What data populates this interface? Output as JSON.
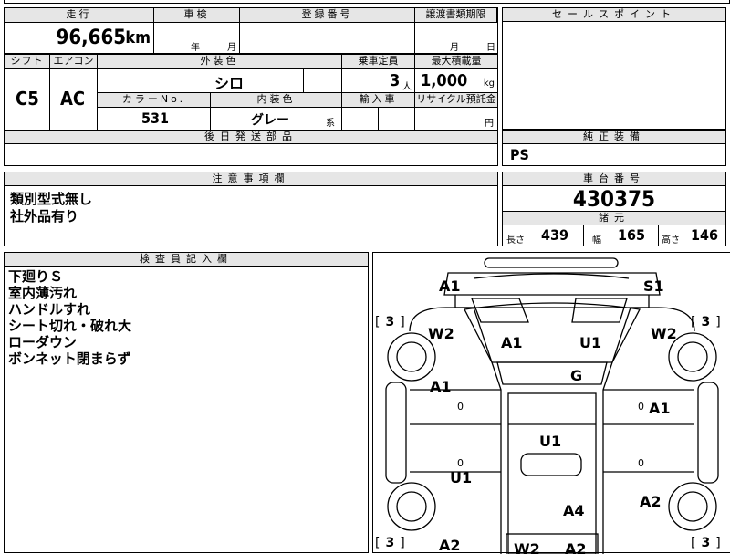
{
  "top_fragment": {
    "text": "…"
  },
  "basic": {
    "mileage_label": "走行",
    "mileage_value": "96,665",
    "mileage_unit": "km",
    "inspection_label": "車検",
    "inspection_year": "年",
    "inspection_month": "月",
    "reg_label": "登録番号",
    "transfer_label": "譲渡書類期限",
    "transfer_month": "月",
    "transfer_day": "日"
  },
  "spec": {
    "shift_label": "シフト",
    "shift_value": "C5",
    "aircon_label": "エアコン",
    "aircon_value": "AC",
    "exterior_label": "外装色",
    "exterior_value": "シロ",
    "capacity_label": "乗車定員",
    "capacity_value": "3",
    "capacity_unit": "人",
    "load_label": "最大積載量",
    "load_value": "1,000",
    "load_unit": "kg",
    "color_no_label": "カラーNo.",
    "color_no_value": "531",
    "interior_label": "内装色",
    "interior_value": "グレー",
    "interior_suffix": "系",
    "import_label": "輸入車",
    "recycle_label": "リサイクル預託金",
    "recycle_unit": "円"
  },
  "later_parts": {
    "label": "後日発送部品"
  },
  "notice": {
    "label": "注意事項欄",
    "lines": [
      "類別型式無し",
      "社外品有り"
    ]
  },
  "sales_point": {
    "label": "セールスポイント"
  },
  "equipment": {
    "label": "純正装備",
    "value": "PS"
  },
  "chassis": {
    "label": "車台番号",
    "value": "430375"
  },
  "dimensions": {
    "label": "諸元",
    "length_label": "長さ",
    "length_value": "439",
    "width_label": "幅",
    "width_value": "165",
    "height_label": "高さ",
    "height_value": "146"
  },
  "inspector": {
    "label": "検査員記入欄",
    "lines": [
      "下廻りＳ",
      "室内薄汚れ",
      "ハンドルすれ",
      "シート切れ・破れ大",
      "ローダウン",
      "ボンネット閉まらず"
    ]
  },
  "diagram": {
    "marks": {
      "front_left": "A1",
      "front_right": "S1",
      "fender_left": "W2",
      "fender_right": "W2",
      "bonnet_left": "A1",
      "bonnet_right": "U1",
      "glass": "G",
      "door_left": "A1",
      "door_right": "A1",
      "roof": "U1",
      "rocker_left": "U1",
      "rear_right": "A2",
      "bed": "A4",
      "rear_left": "A2",
      "rear_w": "W2",
      "rear_a": "A2"
    },
    "tire_fl": "3",
    "tire_fr": "3",
    "tire_rl": "3",
    "tire_rr": "3",
    "zero": "0"
  }
}
